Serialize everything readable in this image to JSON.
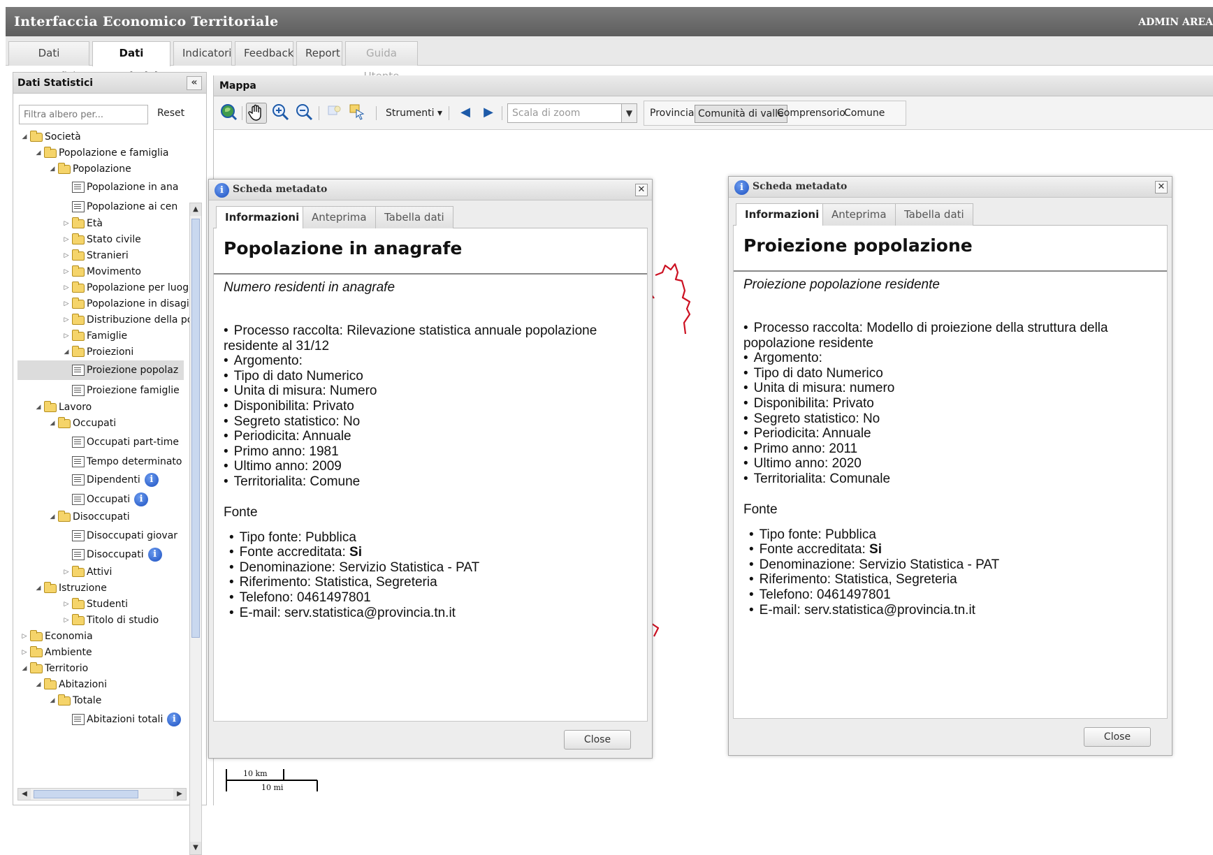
{
  "app": {
    "title": "Interfaccia Economico Territoriale",
    "admin": "ADMIN AREA"
  },
  "main_tabs": [
    {
      "label": "Dati Geografici"
    },
    {
      "label": "Dati Statistici"
    },
    {
      "label": "Indicatori"
    },
    {
      "label": "Feedback"
    },
    {
      "label": "Report"
    },
    {
      "label": "Guida Utente"
    }
  ],
  "sidebar": {
    "title": "Dati Statistici",
    "collapse": "«",
    "filter_placeholder": "Filtra albero per...",
    "reset": "Reset",
    "tree": [
      {
        "label": "Società"
      },
      {
        "label": "Popolazione e famiglia"
      },
      {
        "label": "Popolazione"
      },
      {
        "label": "Popolazione in ana"
      },
      {
        "label": "Popolazione ai cen"
      },
      {
        "label": "Età"
      },
      {
        "label": "Stato civile"
      },
      {
        "label": "Stranieri"
      },
      {
        "label": "Movimento"
      },
      {
        "label": "Popolazione per luogo"
      },
      {
        "label": "Popolazione in disagio"
      },
      {
        "label": "Distribuzione della pop"
      },
      {
        "label": "Famiglie"
      },
      {
        "label": "Proiezioni"
      },
      {
        "label": "Proiezione popolaz"
      },
      {
        "label": "Proiezione famiglie"
      },
      {
        "label": "Lavoro"
      },
      {
        "label": "Occupati"
      },
      {
        "label": "Occupati part-time"
      },
      {
        "label": "Tempo determinato"
      },
      {
        "label": "Dipendenti"
      },
      {
        "label": "Occupati"
      },
      {
        "label": "Disoccupati"
      },
      {
        "label": "Disoccupati giovar"
      },
      {
        "label": "Disoccupati"
      },
      {
        "label": "Attivi"
      },
      {
        "label": "Istruzione"
      },
      {
        "label": "Studenti"
      },
      {
        "label": "Titolo di studio"
      },
      {
        "label": "Economia"
      },
      {
        "label": "Ambiente"
      },
      {
        "label": "Territorio"
      },
      {
        "label": "Abitazioni"
      },
      {
        "label": "Totale"
      },
      {
        "label": "Abitazioni totali"
      }
    ]
  },
  "map": {
    "title": "Mappa",
    "strumenti": "Strumenti",
    "zoom_placeholder": "Scala di zoom",
    "scale_buttons": [
      "Provincia",
      "Comunità di valle",
      "Comprensorio",
      "Comune"
    ],
    "active_scale": "Comunità di valle",
    "scalebar_km": "10 km",
    "scalebar_mi": "10 mi",
    "boundary_color": "#cc1122"
  },
  "window_left": {
    "title": "Scheda metadato",
    "tabs": [
      "Informazioni",
      "Anteprima",
      "Tabella dati"
    ],
    "doc_title": "Popolazione in anagrafe",
    "subtitle": "Numero residenti in anagrafe",
    "details": [
      "Processo raccolta: Rilevazione statistica annuale popolazione residente al 31/12",
      "Argomento:",
      "Tipo di dato Numerico",
      "Unita di misura: Numero",
      "Disponibilita: Privato",
      "Segreto statistico: No",
      "Periodicita: Annuale",
      "Primo anno: 1981",
      "Ultimo anno: 2009",
      "Territorialita: Comune"
    ],
    "fonte_label": "Fonte",
    "fonte": [
      "Tipo fonte: Pubblica",
      "Fonte accreditata: ",
      "Denominazione: Servizio Statistica - PAT",
      "Riferimento: Statistica, Segreteria",
      "Telefono: 0461497801",
      "E-mail: serv.statistica@provincia.tn.it"
    ],
    "fonte_accreditata_value": "Si",
    "close": "Close"
  },
  "window_right": {
    "title": "Scheda metadato",
    "tabs": [
      "Informazioni",
      "Anteprima",
      "Tabella dati"
    ],
    "doc_title": "Proiezione popolazione",
    "subtitle": "Proiezione popolazione residente",
    "details": [
      "Processo raccolta: Modello di proiezione della struttura della popolazione residente",
      "Argomento:",
      "Tipo di dato Numerico",
      "Unita di misura: numero",
      "Disponibilita: Privato",
      "Segreto statistico: No",
      "Periodicita: Annuale",
      "Primo anno: 2011",
      "Ultimo anno: 2020",
      "Territorialita: Comunale"
    ],
    "fonte_label": "Fonte",
    "fonte": [
      "Tipo fonte: Pubblica",
      "Fonte accreditata: ",
      "Denominazione: Servizio Statistica - PAT",
      "Riferimento: Statistica, Segreteria",
      "Telefono: 0461497801",
      "E-mail: serv.statistica@provincia.tn.it"
    ],
    "fonte_accreditata_value": "Si",
    "close": "Close"
  }
}
